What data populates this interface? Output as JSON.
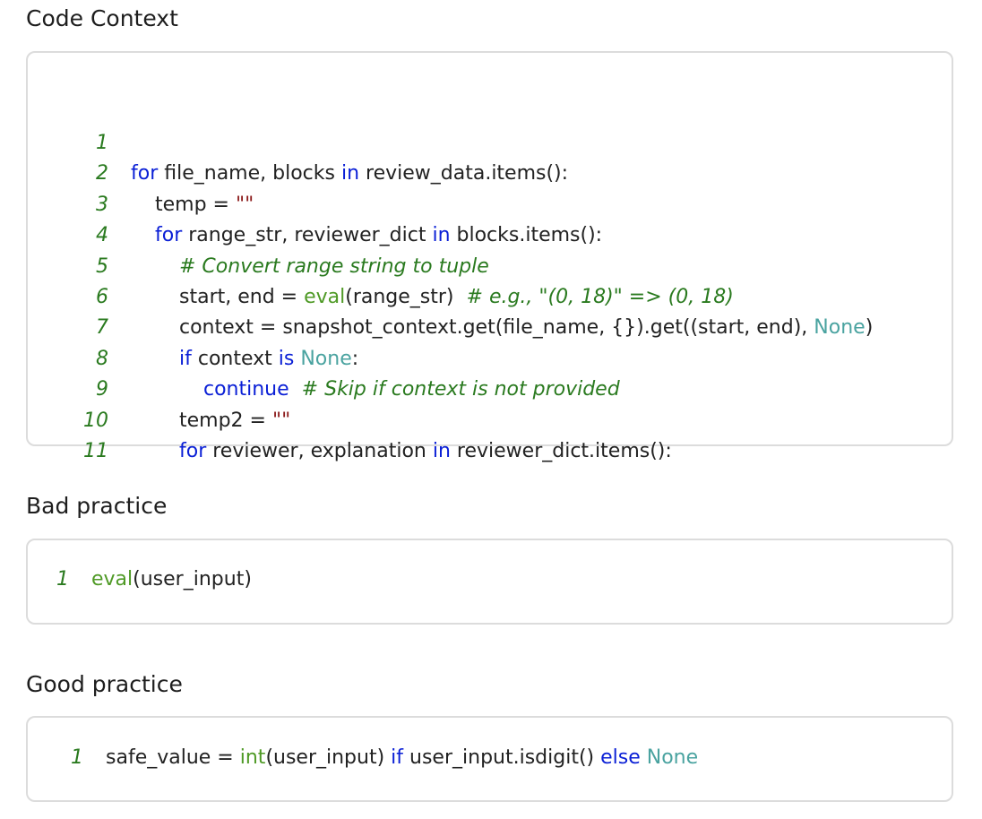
{
  "sections": {
    "context_title": "Code Context",
    "bad_title": "Bad practice",
    "good_title": "Good practice"
  },
  "context_code": [
    {
      "n": "1",
      "indent": 0,
      "tokens": []
    },
    {
      "n": "2",
      "indent": 0,
      "tokens": [
        {
          "t": "for",
          "c": "kw"
        },
        {
          "t": " file_name, blocks ",
          "c": "id"
        },
        {
          "t": "in",
          "c": "kw"
        },
        {
          "t": " review_data.items():",
          "c": "id"
        }
      ]
    },
    {
      "n": "3",
      "indent": 1,
      "tokens": [
        {
          "t": "temp = ",
          "c": "id"
        },
        {
          "t": "\"\"",
          "c": "str"
        }
      ]
    },
    {
      "n": "4",
      "indent": 1,
      "tokens": [
        {
          "t": "for",
          "c": "kw"
        },
        {
          "t": " range_str, reviewer_dict ",
          "c": "id"
        },
        {
          "t": "in",
          "c": "kw"
        },
        {
          "t": " blocks.items():",
          "c": "id"
        }
      ]
    },
    {
      "n": "5",
      "indent": 2,
      "tokens": [
        {
          "t": "# Convert range string to tuple",
          "c": "cm"
        }
      ]
    },
    {
      "n": "6",
      "indent": 2,
      "tokens": [
        {
          "t": "start, end = ",
          "c": "id"
        },
        {
          "t": "eval",
          "c": "fn"
        },
        {
          "t": "(range_str)  ",
          "c": "id"
        },
        {
          "t": "# e.g., \"(0, 18)\" => (0, 18)",
          "c": "cm"
        }
      ]
    },
    {
      "n": "7",
      "indent": 2,
      "tokens": [
        {
          "t": "context = snapshot_context.get(file_name, {}).get((start, end), ",
          "c": "id"
        },
        {
          "t": "None",
          "c": "const"
        },
        {
          "t": ")",
          "c": "id"
        }
      ]
    },
    {
      "n": "8",
      "indent": 2,
      "tokens": [
        {
          "t": "if",
          "c": "kw"
        },
        {
          "t": " context ",
          "c": "id"
        },
        {
          "t": "is",
          "c": "kw"
        },
        {
          "t": " ",
          "c": "id"
        },
        {
          "t": "None",
          "c": "const"
        },
        {
          "t": ":",
          "c": "id"
        }
      ]
    },
    {
      "n": "9",
      "indent": 3,
      "tokens": [
        {
          "t": "continue",
          "c": "kw"
        },
        {
          "t": "  ",
          "c": "id"
        },
        {
          "t": "# Skip if context is not provided",
          "c": "cm"
        }
      ]
    },
    {
      "n": "10",
      "indent": 2,
      "tokens": [
        {
          "t": "temp2 = ",
          "c": "id"
        },
        {
          "t": "\"\"",
          "c": "str"
        }
      ]
    },
    {
      "n": "11",
      "indent": 2,
      "tokens": [
        {
          "t": "for",
          "c": "kw"
        },
        {
          "t": " reviewer, explanation ",
          "c": "id"
        },
        {
          "t": "in",
          "c": "kw"
        },
        {
          "t": " reviewer_dict.items():",
          "c": "id"
        }
      ]
    }
  ],
  "bad_code": [
    {
      "n": "1",
      "indent": 0,
      "tokens": [
        {
          "t": "eval",
          "c": "fn"
        },
        {
          "t": "(user_input)",
          "c": "id"
        }
      ]
    }
  ],
  "good_code": [
    {
      "n": "1",
      "indent": 0,
      "tokens": [
        {
          "t": "safe_value = ",
          "c": "id"
        },
        {
          "t": "int",
          "c": "fn"
        },
        {
          "t": "(user_input) ",
          "c": "id"
        },
        {
          "t": "if",
          "c": "kw"
        },
        {
          "t": " user_input.isdigit() ",
          "c": "id"
        },
        {
          "t": "else",
          "c": "kw"
        },
        {
          "t": " ",
          "c": "id"
        },
        {
          "t": "None",
          "c": "const"
        }
      ]
    }
  ],
  "colors": {
    "keyword": "#0a1fd6",
    "string": "#8b1a1a",
    "comment": "#2a7a1f",
    "builtin": "#4f9a26",
    "constant": "#4aa3a0",
    "line_number": "#2a7a1f",
    "border": "#dcdcdc"
  }
}
